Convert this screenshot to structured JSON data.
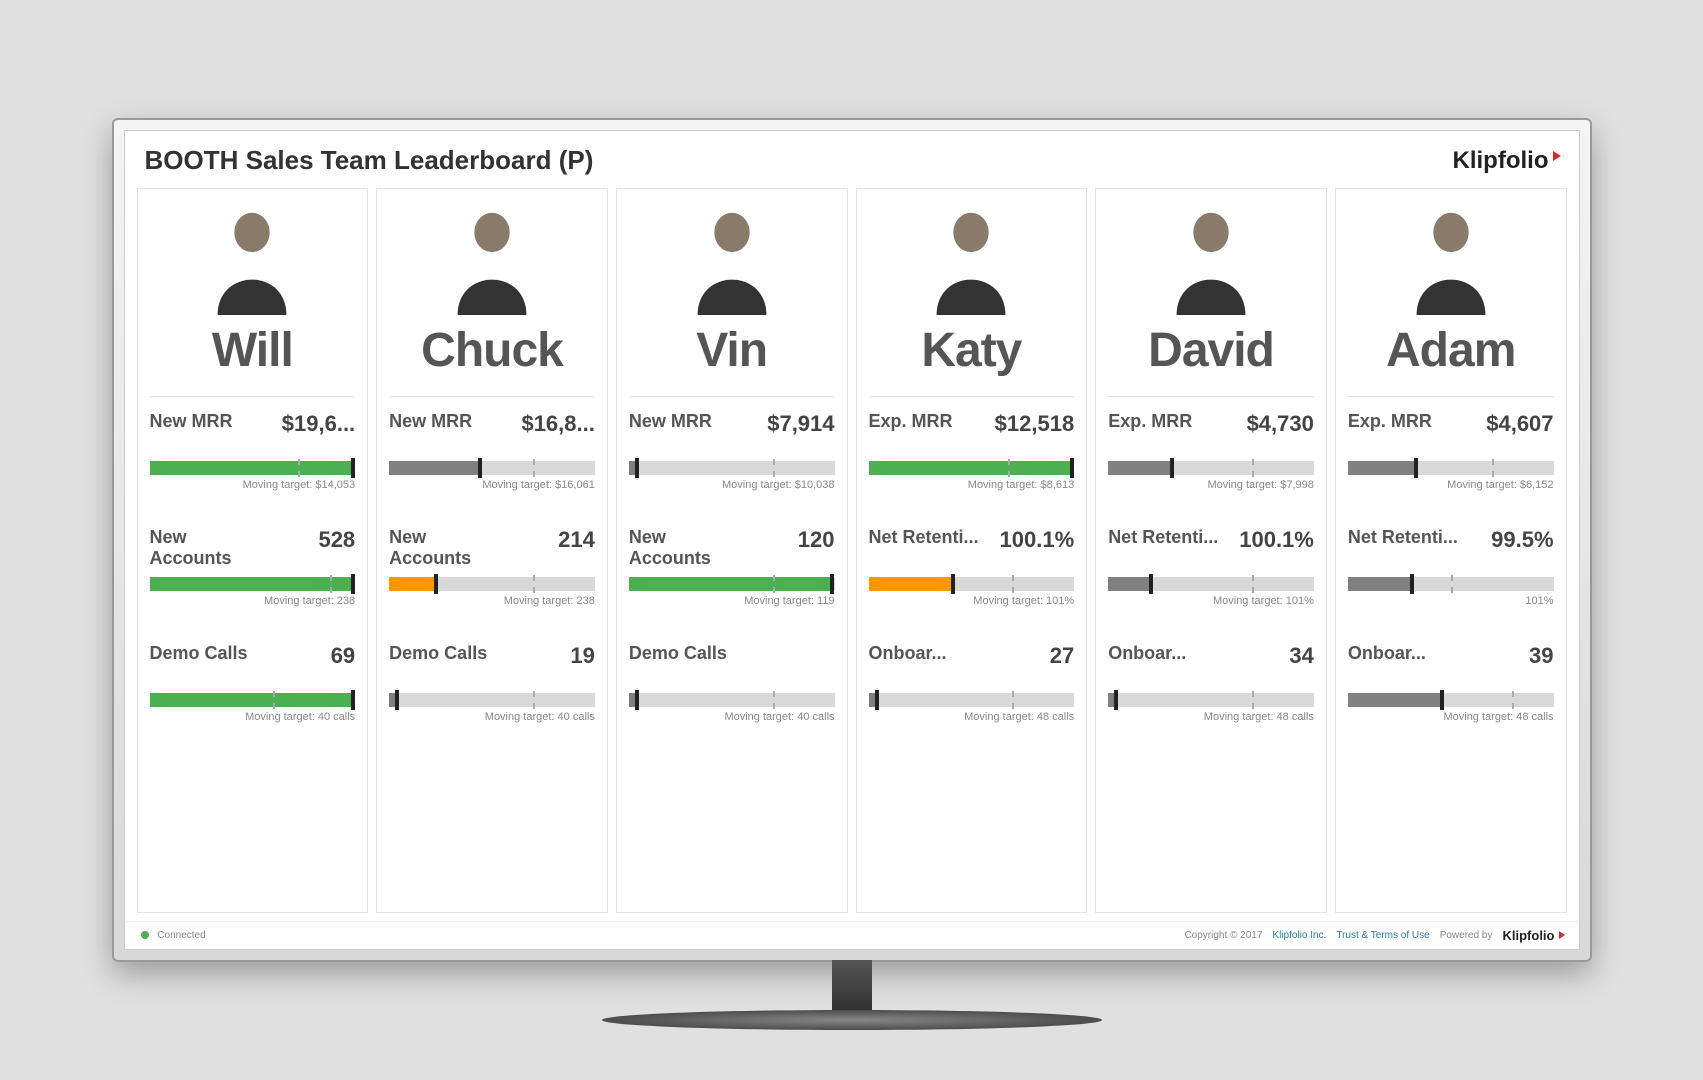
{
  "header": {
    "title": "BOOTH Sales Team Leaderboard (P)",
    "brand": "Klipfolio"
  },
  "footer": {
    "status": "Connected",
    "copyright": "Copyright © 2017",
    "company_link": "Klipfolio Inc.",
    "terms_link": "Trust & Terms of Use",
    "powered_label": "Powered by",
    "brand": "Klipfolio"
  },
  "members": [
    {
      "name": "Will",
      "metrics": [
        {
          "label": "New MRR",
          "value": "$19,6...",
          "fill_pct": 98,
          "fill_color": "green",
          "marker_pct": 98,
          "target_line_pct": 72,
          "target_text": "Moving target: $14,053"
        },
        {
          "label": "New Accounts",
          "value": "528",
          "fill_pct": 98,
          "fill_color": "green",
          "marker_pct": 98,
          "target_line_pct": 88,
          "target_text": "Moving target: 238"
        },
        {
          "label": "Demo Calls",
          "value": "69",
          "fill_pct": 98,
          "fill_color": "green",
          "marker_pct": 98,
          "target_line_pct": 60,
          "target_text": "Moving target: 40 calls"
        }
      ]
    },
    {
      "name": "Chuck",
      "metrics": [
        {
          "label": "New MRR",
          "value": "$16,8...",
          "fill_pct": 43,
          "fill_color": "gray",
          "marker_pct": 43,
          "target_line_pct": 70,
          "target_text": "Moving target: $16,061"
        },
        {
          "label": "New Accounts",
          "value": "214",
          "fill_pct": 22,
          "fill_color": "orange",
          "marker_pct": 22,
          "target_line_pct": 70,
          "target_text": "Moving target: 238"
        },
        {
          "label": "Demo Calls",
          "value": "19",
          "fill_pct": 3,
          "fill_color": "gray",
          "marker_pct": 3,
          "target_line_pct": 70,
          "target_text": "Moving target: 40 calls"
        }
      ]
    },
    {
      "name": "Vin",
      "metrics": [
        {
          "label": "New MRR",
          "value": "$7,914",
          "fill_pct": 3,
          "fill_color": "gray",
          "marker_pct": 3,
          "target_line_pct": 70,
          "target_text": "Moving target: $10,038"
        },
        {
          "label": "New Accounts",
          "value": "120",
          "fill_pct": 98,
          "fill_color": "green",
          "marker_pct": 98,
          "target_line_pct": 70,
          "target_text": "Moving target: 119"
        },
        {
          "label": "Demo Calls",
          "value": "",
          "fill_pct": 3,
          "fill_color": "gray",
          "marker_pct": 3,
          "target_line_pct": 70,
          "target_text": "Moving target: 40 calls"
        }
      ]
    },
    {
      "name": "Katy",
      "metrics": [
        {
          "label": "Exp. MRR",
          "value": "$12,518",
          "fill_pct": 98,
          "fill_color": "green",
          "marker_pct": 98,
          "target_line_pct": 68,
          "target_text": "Moving target: $8,613"
        },
        {
          "label": "Net Retenti...",
          "value": "100.1%",
          "fill_pct": 40,
          "fill_color": "orange",
          "marker_pct": 40,
          "target_line_pct": 70,
          "target_text": "Moving target: 101%"
        },
        {
          "label": "Onboar...",
          "value": "27",
          "fill_pct": 3,
          "fill_color": "gray",
          "marker_pct": 3,
          "target_line_pct": 70,
          "target_text": "Moving target: 48 calls"
        }
      ]
    },
    {
      "name": "David",
      "metrics": [
        {
          "label": "Exp. MRR",
          "value": "$4,730",
          "fill_pct": 30,
          "fill_color": "gray",
          "marker_pct": 30,
          "target_line_pct": 70,
          "target_text": "Moving target: $7,998"
        },
        {
          "label": "Net Retenti...",
          "value": "100.1%",
          "fill_pct": 20,
          "fill_color": "gray",
          "marker_pct": 20,
          "target_line_pct": 70,
          "target_text": "Moving target: 101%"
        },
        {
          "label": "Onboar...",
          "value": "34",
          "fill_pct": 3,
          "fill_color": "gray",
          "marker_pct": 3,
          "target_line_pct": 70,
          "target_text": "Moving target: 48 calls"
        }
      ]
    },
    {
      "name": "Adam",
      "metrics": [
        {
          "label": "Exp. MRR",
          "value": "$4,607",
          "fill_pct": 32,
          "fill_color": "gray",
          "marker_pct": 32,
          "target_line_pct": 70,
          "target_text": "Moving target: $6,152"
        },
        {
          "label": "Net Retenti...",
          "value": "99.5%",
          "fill_pct": 30,
          "fill_color": "gray",
          "marker_pct": 30,
          "target_line_pct": 50,
          "target_text": "101%"
        },
        {
          "label": "Onboar...",
          "value": "39",
          "fill_pct": 45,
          "fill_color": "gray",
          "marker_pct": 45,
          "target_line_pct": 80,
          "target_text": "Moving target: 48 calls"
        }
      ]
    }
  ]
}
